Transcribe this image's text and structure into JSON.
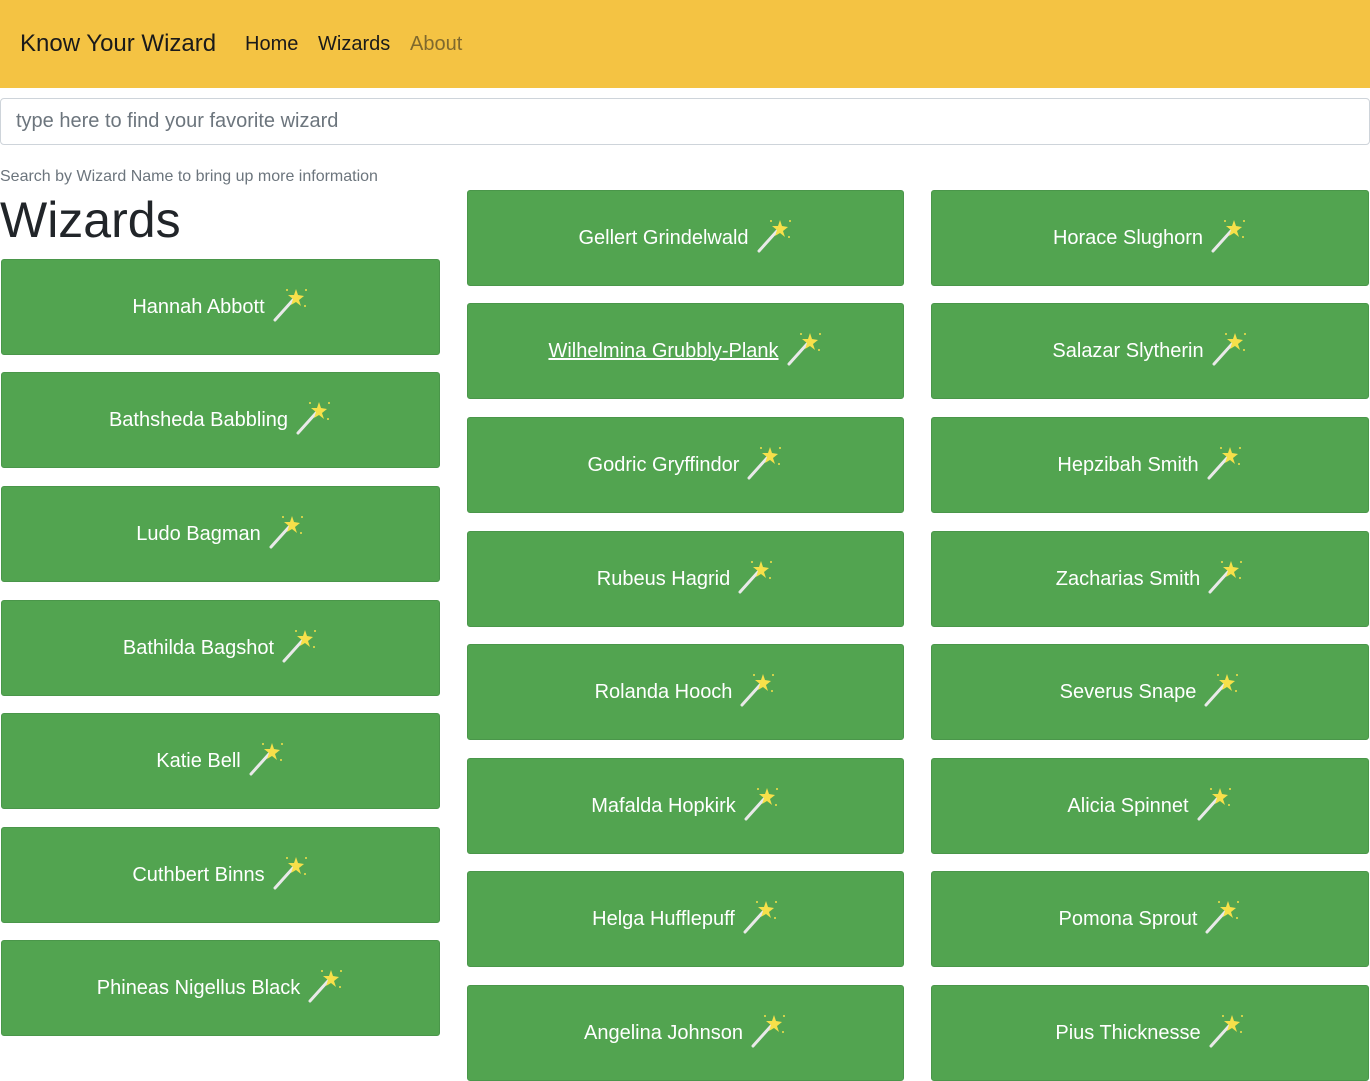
{
  "navbar": {
    "brand": "Know Your Wizard",
    "links": [
      "Home",
      "Wizards",
      "About"
    ]
  },
  "search": {
    "placeholder": "type here to find your favorite wizard"
  },
  "hint": "Search by Wizard Name to bring up more information",
  "heading": "Wizards",
  "columns": [
    [
      "Hannah Abbott",
      "Bathsheda Babbling",
      "Ludo Bagman",
      "Bathilda Bagshot",
      "Katie Bell",
      "Cuthbert Binns",
      "Phineas Nigellus Black"
    ],
    [
      "Gellert Grindelwald",
      "Wilhelmina Grubbly-Plank",
      "Godric Gryffindor",
      "Rubeus Hagrid",
      "Rolanda Hooch",
      "Mafalda Hopkirk",
      "Helga Hufflepuff",
      "Angelina Johnson"
    ],
    [
      "Horace Slughorn",
      "Salazar Slytherin",
      "Hepzibah Smith",
      "Zacharias Smith",
      "Severus Snape",
      "Alicia Spinnet",
      "Pomona Sprout",
      "Pius Thicknesse"
    ]
  ],
  "icon": "magic-wand-icon",
  "colors": {
    "navbar": "#f4c343",
    "card": "#52a450"
  }
}
